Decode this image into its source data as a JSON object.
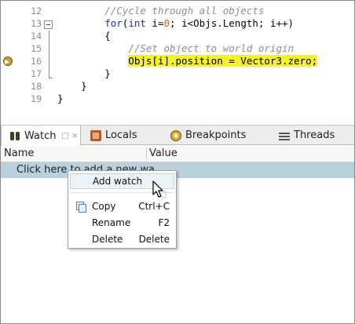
{
  "editor": {
    "lines": [
      {
        "num": "12",
        "parts": [
          {
            "t": "        ",
            "c": ""
          },
          {
            "t": "//Cycle through all objects",
            "c": "comment"
          }
        ]
      },
      {
        "num": "13",
        "parts": [
          {
            "t": "        ",
            "c": ""
          },
          {
            "t": "for",
            "c": "kw"
          },
          {
            "t": "(",
            "c": ""
          },
          {
            "t": "int",
            "c": "kw"
          },
          {
            "t": " i=",
            "c": ""
          },
          {
            "t": "0",
            "c": "num"
          },
          {
            "t": "; i<Objs.Length; i++)",
            "c": ""
          }
        ]
      },
      {
        "num": "14",
        "parts": [
          {
            "t": "        {",
            "c": ""
          }
        ]
      },
      {
        "num": "15",
        "parts": [
          {
            "t": "            ",
            "c": ""
          },
          {
            "t": "//Set object to world origin",
            "c": "comment"
          }
        ]
      },
      {
        "num": "16",
        "parts": [
          {
            "t": "            Objs[i].position = Vector3.zero;",
            "c": ""
          }
        ]
      },
      {
        "num": "17",
        "parts": [
          {
            "t": "        }",
            "c": ""
          }
        ]
      },
      {
        "num": "18",
        "parts": [
          {
            "t": "    }",
            "c": ""
          }
        ]
      },
      {
        "num": "19",
        "parts": [
          {
            "t": "}",
            "c": ""
          }
        ]
      }
    ],
    "highlight_color": "#f4f02c",
    "breakpoint_icon": "breakpoint-arrow-icon"
  },
  "tabs": [
    {
      "label": "Watch",
      "icon": "binoculars-icon",
      "active": true,
      "controls": "□ ×"
    },
    {
      "label": "Locals",
      "icon": "locals-icon",
      "active": false
    },
    {
      "label": "Breakpoints",
      "icon": "breakpoints-icon",
      "active": false
    },
    {
      "label": "Threads",
      "icon": "threads-icon",
      "active": false
    }
  ],
  "grid": {
    "columns": [
      "Name",
      "Value"
    ],
    "add_row_text": "Click here to add a new wa"
  },
  "context_menu": {
    "items": [
      {
        "label": "Add watch",
        "shortcut": "",
        "icon": ""
      },
      {
        "label": "Copy",
        "shortcut": "Ctrl+C",
        "icon": "copy-icon"
      },
      {
        "label": "Rename",
        "shortcut": "F2",
        "icon": ""
      },
      {
        "label": "Delete",
        "shortcut": "Delete",
        "icon": ""
      }
    ]
  },
  "colors": {
    "row_selected": "#b9d1dc",
    "keyword": "#1d2bc8",
    "comment": "#8a8aa6"
  }
}
